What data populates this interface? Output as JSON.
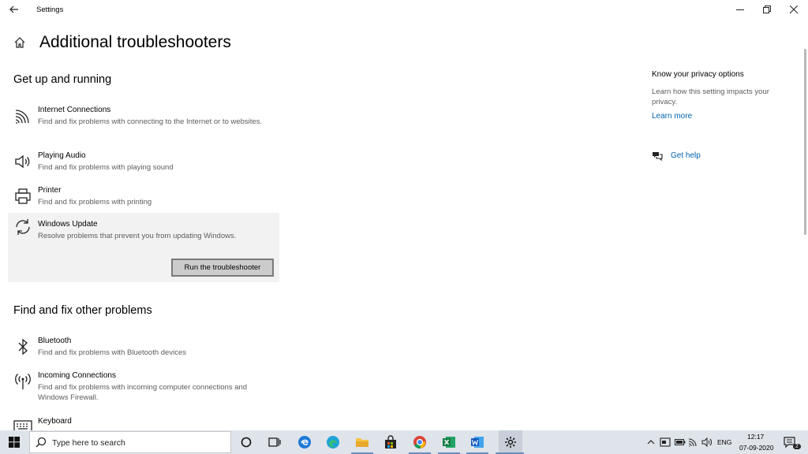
{
  "window": {
    "title": "Settings",
    "back_icon": "back-arrow-icon",
    "controls": [
      "minimize-icon",
      "restore-icon",
      "close-icon"
    ]
  },
  "page": {
    "title": "Additional troubleshooters",
    "home_icon": "home-icon"
  },
  "sections": [
    {
      "title": "Get up and running",
      "items": [
        {
          "name": "Internet Connections",
          "desc": "Find and fix problems with connecting to the Internet or to websites.",
          "icon": "wifi-icon"
        },
        {
          "name": "Playing Audio",
          "desc": "Find and fix problems with playing sound",
          "icon": "speaker-icon"
        },
        {
          "name": "Printer",
          "desc": "Find and fix problems with printing",
          "icon": "printer-icon"
        },
        {
          "name": "Windows Update",
          "desc": "Resolve problems that prevent you from updating Windows.",
          "icon": "refresh-icon",
          "selected": true,
          "button": "Run the troubleshooter"
        }
      ]
    },
    {
      "title": "Find and fix other problems",
      "items": [
        {
          "name": "Bluetooth",
          "desc": "Find and fix problems with Bluetooth devices",
          "icon": "bluetooth-icon"
        },
        {
          "name": "Incoming Connections",
          "desc": "Find and fix problems with incoming computer connections and Windows Firewall.",
          "icon": "antenna-icon"
        },
        {
          "name": "Keyboard",
          "desc": "",
          "icon": "keyboard-icon"
        }
      ]
    }
  ],
  "right_column": {
    "privacy_heading": "Know your privacy options",
    "privacy_text": "Learn how this setting impacts your privacy.",
    "learn_more": "Learn more",
    "get_help": "Get help",
    "help_icon": "chat-bubbles-icon"
  },
  "taskbar": {
    "search_placeholder": "Type here to search",
    "apps": [
      "cortana-icon",
      "task-view-icon",
      "edge-legacy-icon",
      "edge-icon",
      "file-explorer-icon",
      "store-icon",
      "chrome-icon",
      "excel-icon",
      "word-icon",
      "settings-gear-icon"
    ],
    "language": "ENG",
    "time": "12:17",
    "date": "07-09-2020"
  },
  "colors": {
    "accent_link": "#0063b1",
    "selected_bg": "#f2f2f2",
    "taskbar_bg": "#dfe3ea"
  }
}
